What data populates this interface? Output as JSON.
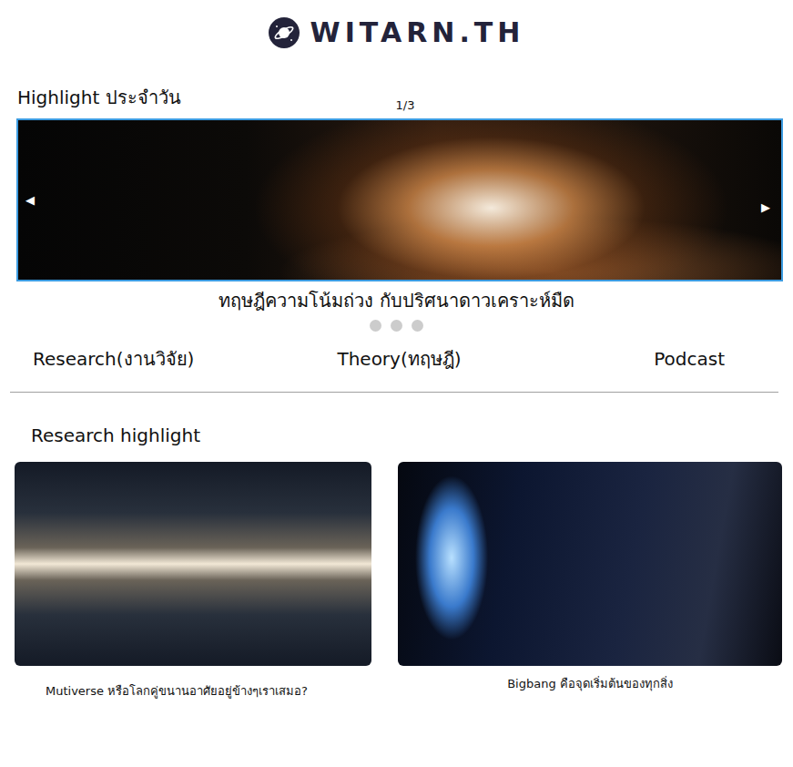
{
  "header": {
    "logo": "WITARN.TH"
  },
  "highlight": {
    "title": "Highlight ประจำวัน",
    "counter": "1/3",
    "prev": "◀",
    "next": "▶",
    "caption": "ทฤษฎีความโน้มถ่วง กับปริศนาดาวเคราะห์มืด",
    "dots": [
      {
        "selected": false
      },
      {
        "selected": false
      },
      {
        "selected": false
      }
    ]
  },
  "nav": [
    {
      "label": "Research(งานวิจัย)"
    },
    {
      "label": "Theory(ทฤษฎี)"
    },
    {
      "label": "Podcast"
    }
  ],
  "research": {
    "title": "Research highlight",
    "cards": [
      {
        "caption": "Mutiverse หรือโลกคู่ขนานอาศัยอยู่ข้างๆเราเสมอ?"
      },
      {
        "caption": "Bigbang คือจุดเริ่มต้นของทุกสิ่ง"
      }
    ]
  }
}
